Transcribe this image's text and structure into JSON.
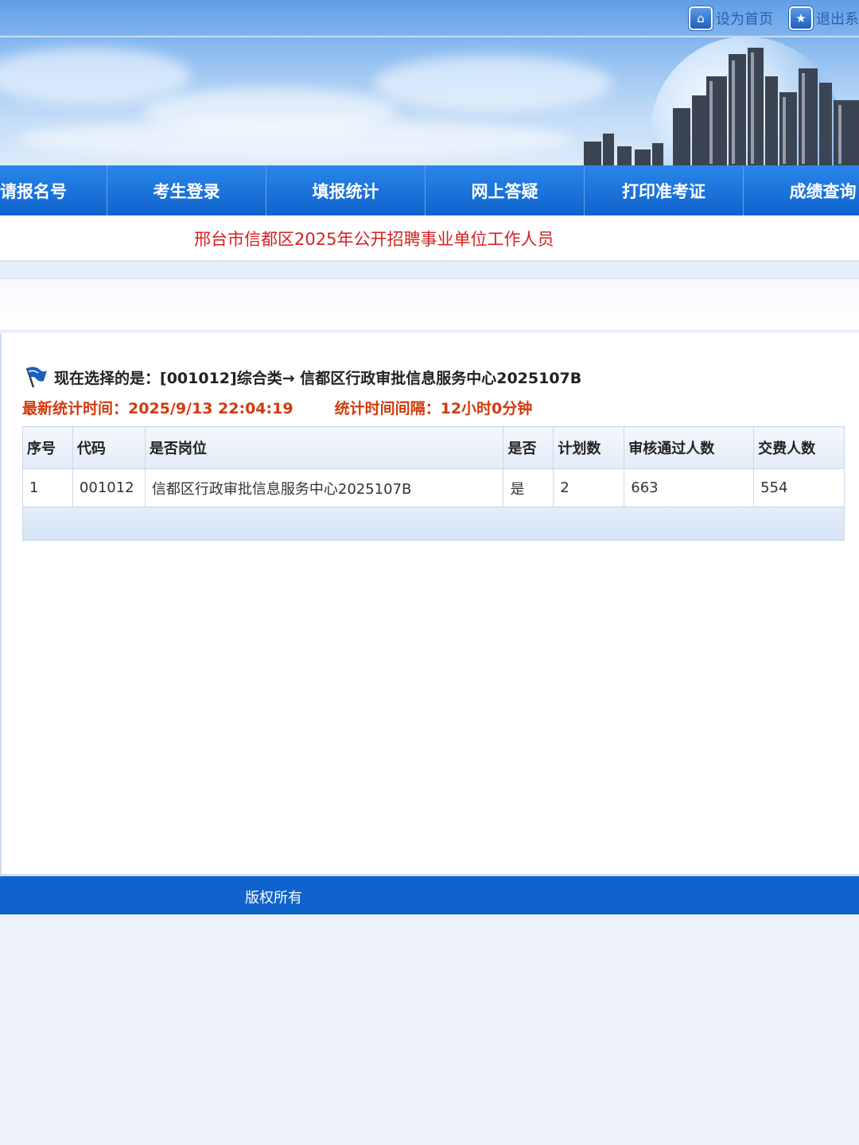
{
  "header": {
    "set_home_label": "设为首页",
    "logout_label": "退出系"
  },
  "nav": {
    "items": [
      "请报名号",
      "考生登录",
      "填报统计",
      "网上答疑",
      "打印准考证",
      "成绩查询"
    ]
  },
  "page_title": "邢台市信都区2025年公开招聘事业单位工作人员",
  "selection": {
    "prefix": "现在选择的是：",
    "value": "[001012]综合类→ 信都区行政审批信息服务中心2025107B"
  },
  "stats": {
    "updated_label": "最新统计时间：",
    "updated_value": "2025/9/13 22:04:19",
    "interval_label": "统计时间间隔：",
    "interval_value": "12小时0分钟"
  },
  "table": {
    "headers": [
      "序号",
      "代码",
      "是否岗位",
      "是否",
      "计划数",
      "审核通过人数",
      "交费人数"
    ],
    "rows": [
      [
        "1",
        "001012",
        "信都区行政审批信息服务中心2025107B",
        "是",
        "2",
        "663",
        "554"
      ]
    ]
  },
  "footer": {
    "copyright": "版权所有"
  },
  "colors": {
    "nav_blue": "#0f63cc",
    "title_red": "#d62020",
    "stats_red": "#d23a0c"
  },
  "icons": {
    "home": "home-icon",
    "star": "star-icon",
    "flag": "flag-icon"
  }
}
